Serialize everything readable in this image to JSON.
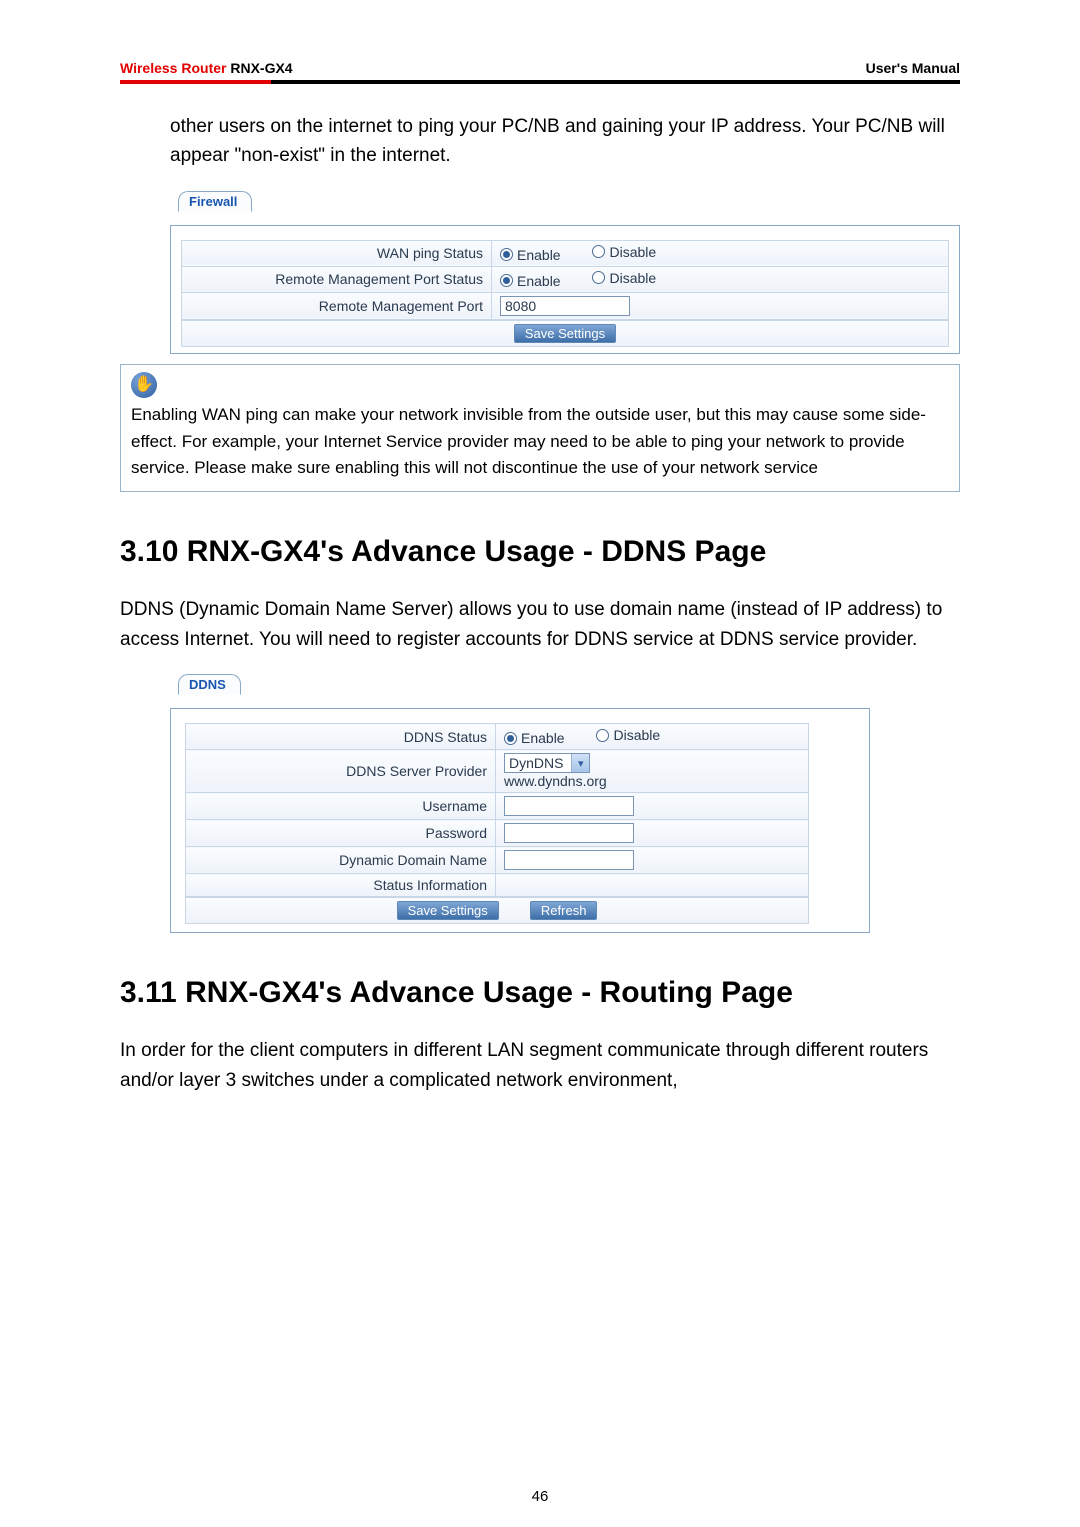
{
  "header": {
    "product_line_red": "Wireless Router",
    "product_model": " RNX-GX4",
    "right": "User's Manual"
  },
  "intro_paragraph_cont": "other users on the internet to ping your PC/NB and gaining your IP address. Your PC/NB will appear \"non-exist\" in the internet.",
  "firewall": {
    "tab": "Firewall",
    "rows": {
      "wan_ping_label": "WAN ping Status",
      "remote_status_label": "Remote Management Port Status",
      "remote_port_label": "Remote Management Port",
      "remote_port_value": "8080",
      "enable": "Enable",
      "disable": "Disable"
    },
    "save_btn": "Save Settings",
    "tip": "Enabling WAN ping can make your network invisible from the outside user, but this may cause some side-effect. For example, your Internet Service provider may need to be able to ping your network to provide service. Please make sure enabling this will not discontinue the use of your network service"
  },
  "section_310": "3.10 RNX-GX4's Advance Usage - DDNS Page",
  "ddns_intro": "DDNS (Dynamic Domain Name Server) allows you to use domain name (instead of IP address) to access Internet. You will need to register accounts for DDNS service at DDNS service provider.",
  "ddns": {
    "tab": "DDNS",
    "status_label": "DDNS Status",
    "enable": "Enable",
    "disable": "Disable",
    "provider_label": "DDNS Server Provider",
    "provider_value": "DynDNS",
    "provider_url": "www.dyndns.org",
    "user_label": "Username",
    "pass_label": "Password",
    "domain_label": "Dynamic Domain Name",
    "statusinfo_label": "Status Information",
    "save_btn": "Save Settings",
    "refresh_btn": "Refresh"
  },
  "section_311": "3.11 RNX-GX4's Advance Usage - Routing Page",
  "routing_intro": "In order for the client computers in different LAN segment communicate through different routers and/or layer 3 switches under a complicated network environment,",
  "page_number": "46"
}
